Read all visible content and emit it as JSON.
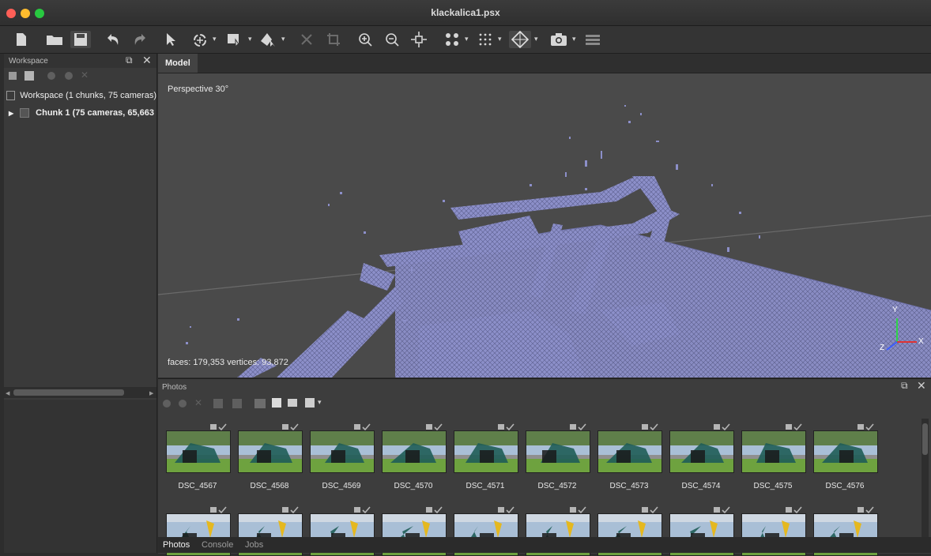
{
  "window": {
    "title": "klackalica1.psx",
    "traffic_colors": [
      "#ff5f57",
      "#febc2e",
      "#28c840"
    ]
  },
  "toolbar": {
    "icons": [
      "new-document-icon",
      "open-folder-icon",
      "save-icon",
      "undo-icon",
      "redo-icon",
      "navigation-icon",
      "rotate-region-icon",
      "rectangle-selection-icon",
      "polygon-selection-icon",
      "delete-icon",
      "crop-icon",
      "zoom-in-icon",
      "zoom-out-icon",
      "reset-view-icon",
      "point-cloud-icon",
      "dense-cloud-icon",
      "model-view-icon",
      "camera-icon",
      "layers-icon"
    ]
  },
  "workspace": {
    "title": "Workspace",
    "root_label": "Workspace (1 chunks, 75 cameras)",
    "chunk_label": "Chunk 1 (75 cameras, 65,663"
  },
  "model": {
    "tab_label": "Model",
    "view_label": "Perspective 30°",
    "stats": "faces: 179,353 vertices: 93,872",
    "axis_labels": {
      "x": "X",
      "y": "Y",
      "z": "Z"
    },
    "mesh_color": "#8c8fc9"
  },
  "photos": {
    "title": "Photos",
    "row1": [
      "DSC_4567",
      "DSC_4568",
      "DSC_4569",
      "DSC_4570",
      "DSC_4571",
      "DSC_4572",
      "DSC_4573",
      "DSC_4574",
      "DSC_4575",
      "DSC_4576"
    ],
    "row2_count": 10
  },
  "bottom_tabs": [
    "Photos",
    "Console",
    "Jobs"
  ]
}
